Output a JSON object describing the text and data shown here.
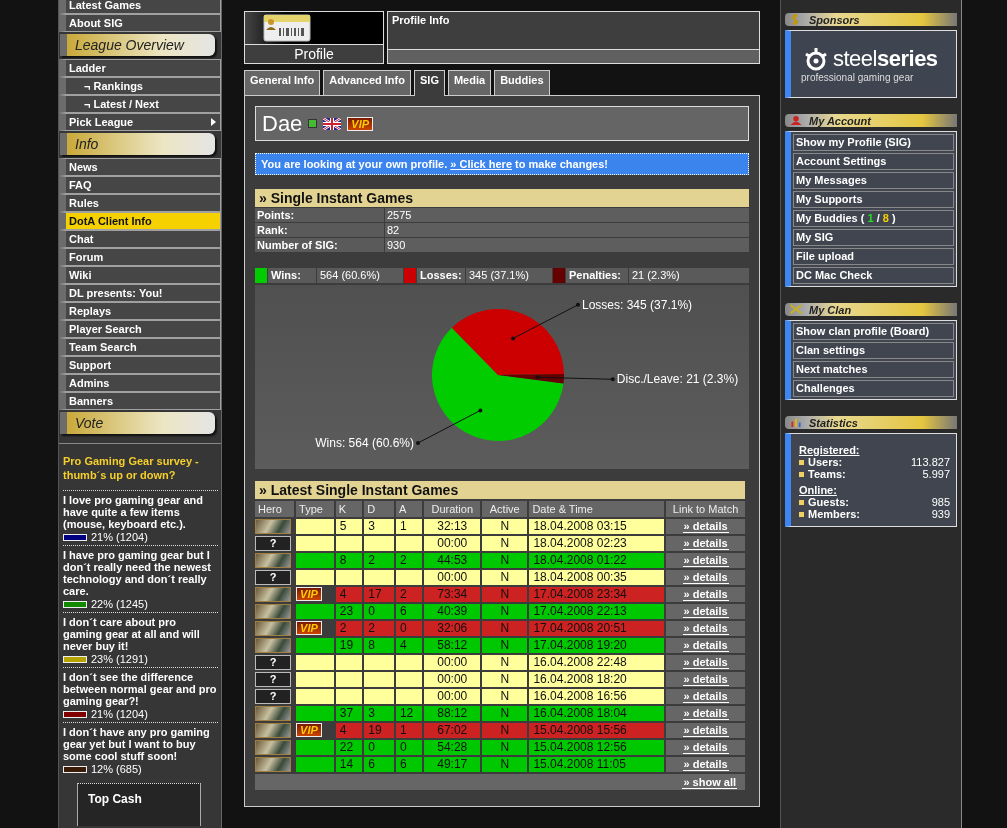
{
  "nav": [
    {
      "kind": "item",
      "label": "Latest Games",
      "selected": false,
      "submenu": false
    },
    {
      "kind": "item",
      "label": "About SIG",
      "selected": false,
      "submenu": false
    },
    {
      "kind": "header",
      "label": "League Overview"
    },
    {
      "kind": "item",
      "label": "Ladder",
      "selected": false,
      "submenu": false,
      "children": [
        {
          "label": "¬ Rankings",
          "selected": false
        },
        {
          "label": "¬ Latest / Next",
          "selected": false
        }
      ]
    },
    {
      "kind": "item",
      "label": "Pick League",
      "selected": false,
      "submenu": true
    },
    {
      "kind": "header",
      "label": "Info"
    },
    {
      "kind": "item",
      "label": "News",
      "selected": false,
      "submenu": false
    },
    {
      "kind": "item",
      "label": "FAQ",
      "selected": false,
      "submenu": false
    },
    {
      "kind": "item",
      "label": "Rules",
      "selected": false,
      "submenu": false
    },
    {
      "kind": "item",
      "label": "DotA Client Info",
      "selected": true,
      "submenu": false
    },
    {
      "kind": "item",
      "label": "Chat",
      "selected": false,
      "submenu": false
    },
    {
      "kind": "item",
      "label": "Forum",
      "selected": false,
      "submenu": false
    },
    {
      "kind": "item",
      "label": "Wiki",
      "selected": false,
      "submenu": false
    },
    {
      "kind": "item",
      "label": "DL presents: You!",
      "selected": false,
      "submenu": false
    },
    {
      "kind": "item",
      "label": "Replays",
      "selected": false,
      "submenu": false
    },
    {
      "kind": "item",
      "label": "Player Search",
      "selected": false,
      "submenu": false
    },
    {
      "kind": "item",
      "label": "Team Search",
      "selected": false,
      "submenu": false
    },
    {
      "kind": "item",
      "label": "Support",
      "selected": false,
      "submenu": false
    },
    {
      "kind": "item",
      "label": "Admins",
      "selected": false,
      "submenu": false
    },
    {
      "kind": "item",
      "label": "Banners",
      "selected": false,
      "submenu": false
    },
    {
      "kind": "header",
      "label": "Vote"
    }
  ],
  "poll": {
    "question": "Pro Gaming Gear survey - thumb´s up or down?",
    "options": [
      {
        "text": "I love pro gaming gear and have quite a few items (mouse, keyboard etc.).",
        "color": "#000080",
        "result": "21% (1204)"
      },
      {
        "text": "I have pro gaming gear but I don´t really need the newest technology and don´t really care.",
        "color": "#128a00",
        "result": "22% (1245)"
      },
      {
        "text": "I don´t care about pro gaming gear at all and will never buy it!",
        "color": "#b8a400",
        "result": "23% (1291)"
      },
      {
        "text": "I don´t see the difference between normal gear and pro gaming gear?!",
        "color": "#800000",
        "result": "21% (1204)"
      },
      {
        "text": "I don´t have any pro gaming gear yet but I want to buy some cool stuff soon!",
        "color": "#3c1c08",
        "result": "12% (685)"
      }
    ]
  },
  "bottom_box": {
    "title": "Top Cash"
  },
  "profile_header": {
    "label": "Profile",
    "info_title": "Profile Info"
  },
  "tabs": [
    {
      "label": "General Info",
      "selected": false
    },
    {
      "label": "Advanced Info",
      "selected": false
    },
    {
      "label": "SIG",
      "selected": true
    },
    {
      "label": "Media",
      "selected": false
    },
    {
      "label": "Buddies",
      "selected": false
    }
  ],
  "player": {
    "name": "Dae",
    "online": true,
    "badge": "VIP"
  },
  "notice": {
    "text": "You are looking at your own profile.",
    "link": "» Click here",
    "after": "to make changes!"
  },
  "sig": {
    "title": "» Single Instant Games",
    "stats": [
      {
        "label": "Points:",
        "value": "2575"
      },
      {
        "label": "Rank:",
        "value": "82"
      },
      {
        "label": "Number of SIG:",
        "value": "930"
      }
    ],
    "legend": [
      {
        "label": "Wins:",
        "value": "564 (60.6%)",
        "color": "#00cc00"
      },
      {
        "label": "Losses:",
        "value": "345 (37.1%)",
        "color": "#cc0000"
      },
      {
        "label": "Penalties:",
        "value": "21 (2.3%)",
        "color": "#660000"
      }
    ],
    "chart_data": {
      "type": "pie",
      "categories": [
        "Wins",
        "Losses",
        "Disc./Leave"
      ],
      "values": [
        564,
        345,
        21
      ],
      "value_labels": [
        "564 (60.6%)",
        "345 (37.1%)",
        "21 (2.3%)"
      ]
    }
  },
  "games": {
    "title": "» Latest Single Instant Games",
    "columns": [
      "Hero",
      "Type",
      "K",
      "D",
      "A",
      "Duration",
      "Active",
      "Date & Time",
      "Link to Match"
    ],
    "rows": [
      {
        "kind": "none",
        "k": "5",
        "d": "3",
        "a": "1",
        "duration": "32:13",
        "active": "N",
        "date": "18.04.2008 03:15",
        "link": "» details"
      },
      {
        "kind": "none",
        "hero": "?",
        "duration": "00:00",
        "active": "N",
        "date": "18.04.2008 02:23",
        "link": "» details"
      },
      {
        "kind": "win",
        "k": "8",
        "d": "2",
        "a": "2",
        "duration": "44:53",
        "active": "N",
        "date": "18.04.2008 01:22",
        "link": "» details"
      },
      {
        "kind": "none",
        "hero": "?",
        "duration": "00:00",
        "active": "N",
        "date": "18.04.2008 00:35",
        "link": "» details"
      },
      {
        "kind": "loss",
        "type": "VIP",
        "k": "4",
        "d": "17",
        "a": "2",
        "duration": "73:34",
        "active": "N",
        "date": "17.04.2008 23:34",
        "link": "» details"
      },
      {
        "kind": "win",
        "k": "23",
        "d": "0",
        "a": "6",
        "duration": "40:39",
        "active": "N",
        "date": "17.04.2008 22:13",
        "link": "» details"
      },
      {
        "kind": "loss",
        "type": "VIP",
        "k": "2",
        "d": "2",
        "a": "0",
        "duration": "32:06",
        "active": "N",
        "date": "17.04.2008 20:51",
        "link": "» details"
      },
      {
        "kind": "win",
        "k": "19",
        "d": "8",
        "a": "4",
        "duration": "58:12",
        "active": "N",
        "date": "17.04.2008 19:20",
        "link": "» details"
      },
      {
        "kind": "none",
        "hero": "?",
        "duration": "00:00",
        "active": "N",
        "date": "16.04.2008 22:48",
        "link": "» details"
      },
      {
        "kind": "none",
        "hero": "?",
        "duration": "00:00",
        "active": "N",
        "date": "16.04.2008 18:20",
        "link": "» details"
      },
      {
        "kind": "none",
        "hero": "?",
        "duration": "00:00",
        "active": "N",
        "date": "16.04.2008 16:56",
        "link": "» details"
      },
      {
        "kind": "win",
        "k": "37",
        "d": "3",
        "a": "12",
        "duration": "88:12",
        "active": "N",
        "date": "16.04.2008 18:04",
        "link": "» details"
      },
      {
        "kind": "loss",
        "type": "VIP",
        "k": "4",
        "d": "19",
        "a": "1",
        "duration": "67:02",
        "active": "N",
        "date": "15.04.2008 15:56",
        "link": "» details"
      },
      {
        "kind": "win",
        "k": "22",
        "d": "0",
        "a": "0",
        "duration": "54:28",
        "active": "N",
        "date": "15.04.2008 12:56",
        "link": "» details"
      },
      {
        "kind": "win",
        "k": "14",
        "d": "6",
        "a": "6",
        "duration": "49:17",
        "active": "N",
        "date": "15.04.2008 11:05",
        "link": "» details"
      }
    ],
    "show_all": "» show all"
  },
  "sponsors": {
    "title": "Sponsors",
    "wordmark": "steel**series**",
    "tagline": "professional gaming gear"
  },
  "account": {
    "title": "My Account",
    "items": [
      {
        "label": "Show my Profile (SIG)"
      },
      {
        "label": "Account Settings"
      },
      {
        "label": "My Messages"
      },
      {
        "label": "My Supports"
      },
      {
        "label": "My Buddies (",
        "online": "1",
        "separator": "/",
        "total": "8",
        "end": ")"
      },
      {
        "label": "My SIG"
      },
      {
        "label": "File upload"
      },
      {
        "label": "DC Mac Check"
      }
    ]
  },
  "clan": {
    "title": "My Clan",
    "items": [
      {
        "label": "Show clan profile (Board)"
      },
      {
        "label": "Clan settings"
      },
      {
        "label": "Next matches"
      },
      {
        "label": "Challenges"
      }
    ]
  },
  "statistics": {
    "title": "Statistics",
    "groups": [
      {
        "title": "Registered:",
        "rows": [
          {
            "label": "Users:",
            "value": "113.827"
          },
          {
            "label": "Teams:",
            "value": "5.997"
          }
        ]
      },
      {
        "title": "Online:",
        "rows": [
          {
            "label": "Guests:",
            "value": "985"
          },
          {
            "label": "Members:",
            "value": "939"
          }
        ]
      }
    ]
  }
}
